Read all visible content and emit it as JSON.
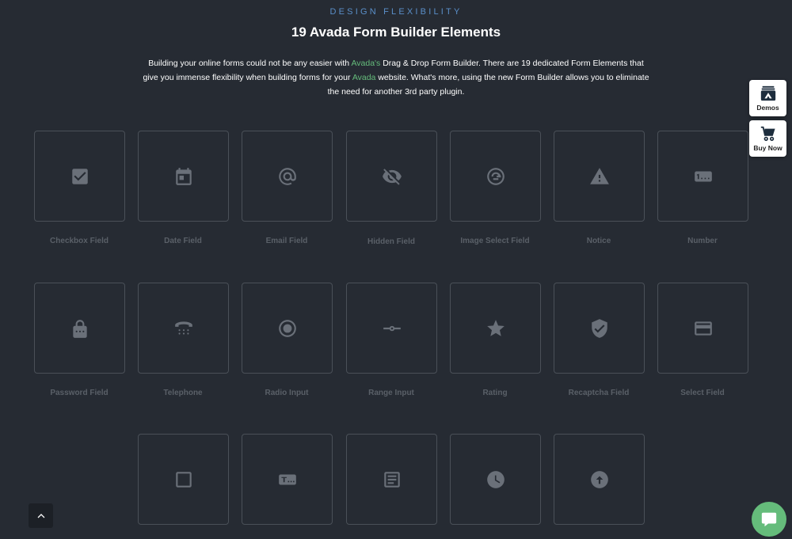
{
  "header": {
    "eyebrow": "DESIGN FLEXIBILITY",
    "title": "19 Avada Form Builder Elements",
    "intro": {
      "part1": "Building your online forms could not be any easier with ",
      "link1": "Avada's",
      "part2": " Drag & Drop Form Builder. There are 19 dedicated Form Elements that give you immense flexibility when building forms for your ",
      "link2": "Avada",
      "part3": " website. What's more, using the new Form Builder allows you to eliminate the need for another 3rd party plugin."
    }
  },
  "elements": [
    {
      "label": "Checkbox Field",
      "icon": "checkbox-icon"
    },
    {
      "label": "Date Field",
      "icon": "calendar-icon"
    },
    {
      "label": "Email Field",
      "icon": "at-sign-icon"
    },
    {
      "label": "Hidden Field",
      "icon": "eye-off-icon"
    },
    {
      "label": "Image Select Field",
      "icon": "image-select-icon"
    },
    {
      "label": "Notice",
      "icon": "warning-icon"
    },
    {
      "label": "Number",
      "icon": "number-icon"
    },
    {
      "label": "Password Field",
      "icon": "lock-icon"
    },
    {
      "label": "Telephone",
      "icon": "phone-icon"
    },
    {
      "label": "Radio Input",
      "icon": "radio-icon"
    },
    {
      "label": "Range Input",
      "icon": "range-icon"
    },
    {
      "label": "Rating",
      "icon": "star-icon"
    },
    {
      "label": "Recaptcha Field",
      "icon": "shield-check-icon"
    },
    {
      "label": "Select Field",
      "icon": "select-icon"
    },
    {
      "label": "",
      "icon": "empty-checkbox-icon"
    },
    {
      "label": "",
      "icon": "text-field-icon"
    },
    {
      "label": "",
      "icon": "textarea-icon"
    },
    {
      "label": "",
      "icon": "clock-icon"
    },
    {
      "label": "",
      "icon": "upload-icon"
    }
  ],
  "sidebar": {
    "demos_label": "Demos",
    "buy_label": "Buy Now"
  },
  "colors": {
    "background": "#262b33",
    "accent_link": "#65bc7b",
    "eyebrow": "#5a8fc9"
  }
}
